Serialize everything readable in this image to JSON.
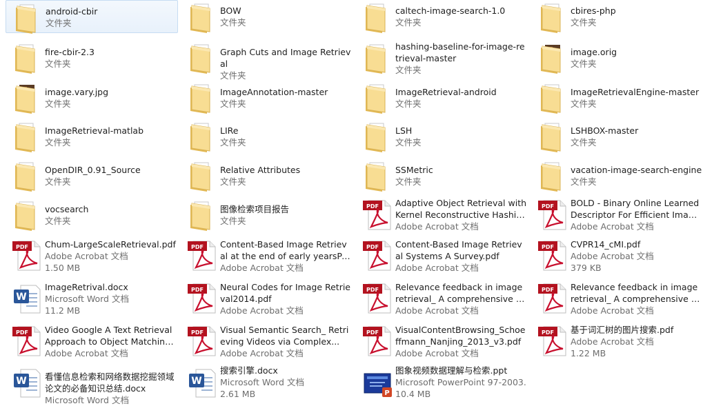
{
  "items": [
    {
      "name": "android-cbir",
      "lines": [
        "文件夹"
      ],
      "icon": "folder-icon",
      "selected": true
    },
    {
      "name": "BOW",
      "lines": [
        "文件夹"
      ],
      "icon": "folder-icon"
    },
    {
      "name": "caltech-image-search-1.0",
      "lines": [
        "文件夹"
      ],
      "icon": "folder-icon"
    },
    {
      "name": "cbires-php",
      "lines": [
        "文件夹"
      ],
      "icon": "folder-icon"
    },
    {
      "name": "fire-cbir-2.3",
      "lines": [
        "文件夹"
      ],
      "icon": "folder-icon"
    },
    {
      "name": "Graph Cuts and Image Retrieval",
      "lines": [
        "文件夹"
      ],
      "icon": "folder-icon"
    },
    {
      "name": "hashing-baseline-for-image-retrieval-master",
      "lines": [
        "文件夹"
      ],
      "icon": "folder-icon"
    },
    {
      "name": "image.orig",
      "lines": [
        "文件夹"
      ],
      "icon": "folder-image-icon"
    },
    {
      "name": "image.vary.jpg",
      "lines": [
        "文件夹"
      ],
      "icon": "folder-image-icon"
    },
    {
      "name": "ImageAnnotation-master",
      "lines": [
        "文件夹"
      ],
      "icon": "folder-icon"
    },
    {
      "name": "ImageRetrieval-android",
      "lines": [
        "文件夹"
      ],
      "icon": "folder-icon"
    },
    {
      "name": "ImageRetrievalEngine-master",
      "lines": [
        "文件夹"
      ],
      "icon": "folder-icon"
    },
    {
      "name": "ImageRetrieval-matlab",
      "lines": [
        "文件夹"
      ],
      "icon": "folder-icon"
    },
    {
      "name": "LIRe",
      "lines": [
        "文件夹"
      ],
      "icon": "folder-icon"
    },
    {
      "name": "LSH",
      "lines": [
        "文件夹"
      ],
      "icon": "folder-icon"
    },
    {
      "name": "LSHBOX-master",
      "lines": [
        "文件夹"
      ],
      "icon": "folder-icon"
    },
    {
      "name": "OpenDIR_0.91_Source",
      "lines": [
        "文件夹"
      ],
      "icon": "folder-icon"
    },
    {
      "name": "Relative Attributes",
      "lines": [
        "文件夹"
      ],
      "icon": "folder-icon"
    },
    {
      "name": "SSMetric",
      "lines": [
        "文件夹"
      ],
      "icon": "folder-icon"
    },
    {
      "name": "vacation-image-search-engine",
      "lines": [
        "文件夹"
      ],
      "icon": "folder-icon"
    },
    {
      "name": "vocsearch",
      "lines": [
        "文件夹"
      ],
      "icon": "folder-icon"
    },
    {
      "name": "图像检索项目报告",
      "lines": [
        "文件夹"
      ],
      "icon": "folder-icon"
    },
    {
      "name": "Adaptive Object Retrieval with Kernel Reconstructive Hashing...",
      "lines": [
        "Adobe Acrobat 文档"
      ],
      "icon": "pdf-icon"
    },
    {
      "name": "BOLD - Binary Online Learned Descriptor For Efficient Image ...",
      "lines": [
        "Adobe Acrobat 文档"
      ],
      "icon": "pdf-icon"
    },
    {
      "name": "Chum-LargeScaleRetrieval.pdf",
      "lines": [
        "Adobe Acrobat 文档",
        "1.50 MB"
      ],
      "icon": "pdf-icon"
    },
    {
      "name": "Content-Based Image Retrieval at the end of early yearsPAMI...",
      "lines": [
        "Adobe Acrobat 文档"
      ],
      "icon": "pdf-icon"
    },
    {
      "name": "Content-Based Image Retrieval Systems A Survey.pdf",
      "lines": [
        "Adobe Acrobat 文档"
      ],
      "icon": "pdf-icon"
    },
    {
      "name": "CVPR14_cMI.pdf",
      "lines": [
        "Adobe Acrobat 文档",
        "379 KB"
      ],
      "icon": "pdf-icon"
    },
    {
      "name": "ImageRetrival.docx",
      "lines": [
        "Microsoft Word 文档",
        "11.2 MB"
      ],
      "icon": "word-icon"
    },
    {
      "name": "Neural Codes for Image Retrieval2014.pdf",
      "lines": [
        "Adobe Acrobat 文档"
      ],
      "icon": "pdf-icon"
    },
    {
      "name": "Relevance feedback in image retrieval_ A comprehensive rev...",
      "lines": [
        "Adobe Acrobat 文档"
      ],
      "icon": "pdf-icon"
    },
    {
      "name": "Relevance feedback in image retrieval_ A comprehensive rev...",
      "lines": [
        "Adobe Acrobat 文档"
      ],
      "icon": "pdf-icon"
    },
    {
      "name": "Video Google A Text Retrieval Approach to Object Matching ...",
      "lines": [
        "Adobe Acrobat 文档"
      ],
      "icon": "pdf-icon"
    },
    {
      "name": "Visual Semantic Search_ Retrieving Videos via Complex...",
      "lines": [
        "Adobe Acrobat 文档"
      ],
      "icon": "pdf-icon"
    },
    {
      "name": "VisualContentBrowsing_Schoeffmann_Nanjing_2013_v3.pdf",
      "lines": [
        "Adobe Acrobat 文档"
      ],
      "icon": "pdf-icon"
    },
    {
      "name": "基于词汇树的图片搜索.pdf",
      "lines": [
        "Adobe Acrobat 文档",
        "1.22 MB"
      ],
      "icon": "pdf-icon"
    },
    {
      "name": "看懂信息检索和网络数据挖掘领域论文的必备知识总结.docx",
      "lines": [
        "Microsoft Word 文档"
      ],
      "icon": "word-icon"
    },
    {
      "name": "搜索引擎.docx",
      "lines": [
        "Microsoft Word 文档",
        "2.61 MB"
      ],
      "icon": "word-icon"
    },
    {
      "name": "图象视频数据理解与检索.ppt",
      "lines": [
        "Microsoft PowerPoint 97-2003...",
        "10.4 MB"
      ],
      "icon": "ppt-icon"
    }
  ],
  "pdf_badge": "PDF",
  "colors": {
    "selection_bg": "#e8f1fb",
    "selection_border": "#c6dcf2",
    "secondary_text": "#6d6d6d",
    "pdf_red": "#c8102e",
    "word_blue": "#2a5699",
    "folder_yellow": "#f5d78a"
  }
}
